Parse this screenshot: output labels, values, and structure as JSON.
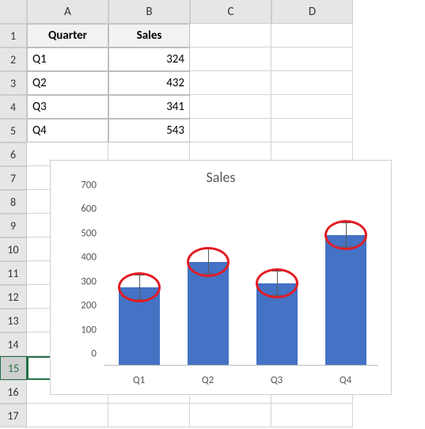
{
  "columns": [
    "A",
    "B",
    "C",
    "D"
  ],
  "rows": [
    "1",
    "2",
    "3",
    "4",
    "5",
    "6",
    "7",
    "8",
    "9",
    "10",
    "11",
    "12",
    "13",
    "14",
    "15",
    "16",
    "17"
  ],
  "selected_row": "15",
  "table": {
    "headers": [
      "Quarter",
      "Sales"
    ],
    "rows": [
      {
        "quarter": "Q1",
        "sales": "324"
      },
      {
        "quarter": "Q2",
        "sales": "432"
      },
      {
        "quarter": "Q3",
        "sales": "341"
      },
      {
        "quarter": "Q4",
        "sales": "543"
      }
    ]
  },
  "chart_data": {
    "type": "bar",
    "title": "Sales",
    "categories": [
      "Q1",
      "Q2",
      "Q3",
      "Q4"
    ],
    "values": [
      324,
      432,
      341,
      543
    ],
    "error_bars": {
      "type": "fixed",
      "amount": 50
    },
    "annotations": "red ovals around top of each error bar",
    "ylim": [
      0,
      700
    ],
    "ytick_step": 100,
    "xlabel": "",
    "ylabel": "",
    "legend": false
  },
  "yticks": [
    "0",
    "100",
    "200",
    "300",
    "400",
    "500",
    "600",
    "700"
  ]
}
